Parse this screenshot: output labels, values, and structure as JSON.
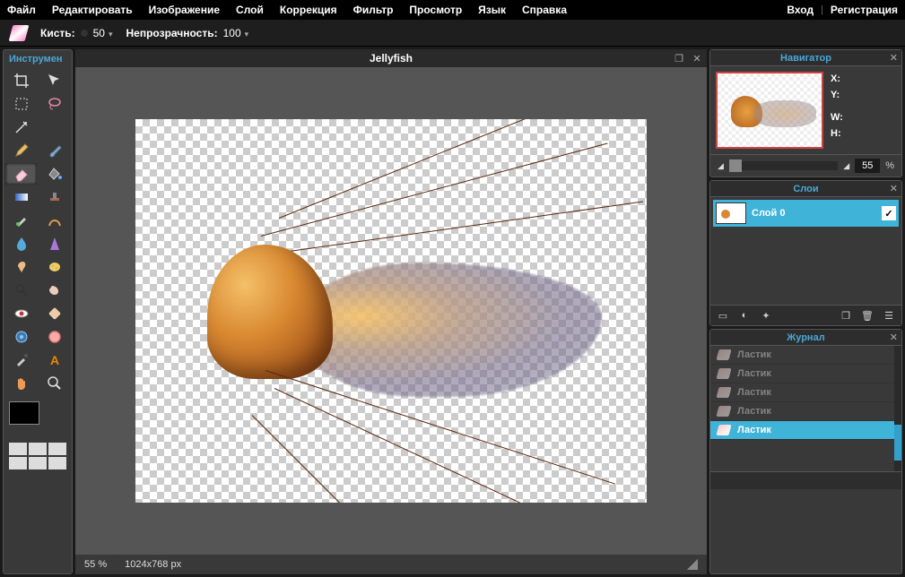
{
  "menu": {
    "items": [
      "Файл",
      "Редактировать",
      "Изображение",
      "Слой",
      "Коррекция",
      "Фильтр",
      "Просмотр",
      "Язык",
      "Справка"
    ],
    "right": {
      "login": "Вход",
      "register": "Регистрация"
    }
  },
  "options": {
    "brush_label": "Кисть:",
    "brush_value": "50",
    "opacity_label": "Непрозрачность:",
    "opacity_value": "100"
  },
  "tools": {
    "title": "Инструмен",
    "active_index": 10
  },
  "canvas": {
    "title": "Jellyfish",
    "zoom": "55",
    "zoom_unit": "%",
    "dimensions": "1024x768 px"
  },
  "navigator": {
    "title": "Навигатор",
    "x_label": "X:",
    "y_label": "Y:",
    "w_label": "W:",
    "h_label": "H:",
    "zoom": "55",
    "zoom_unit": "%"
  },
  "layers": {
    "title": "Слои",
    "items": [
      {
        "name": "Слой 0",
        "visible": true
      }
    ]
  },
  "history": {
    "title": "Журнал",
    "items": [
      {
        "label": "Ластик",
        "active": false
      },
      {
        "label": "Ластик",
        "active": false
      },
      {
        "label": "Ластик",
        "active": false
      },
      {
        "label": "Ластик",
        "active": false
      },
      {
        "label": "Ластик",
        "active": true
      }
    ]
  },
  "colors": {
    "accent": "#3fb4d8",
    "panel_bg": "#393939",
    "title_color": "#4aa8d8"
  }
}
